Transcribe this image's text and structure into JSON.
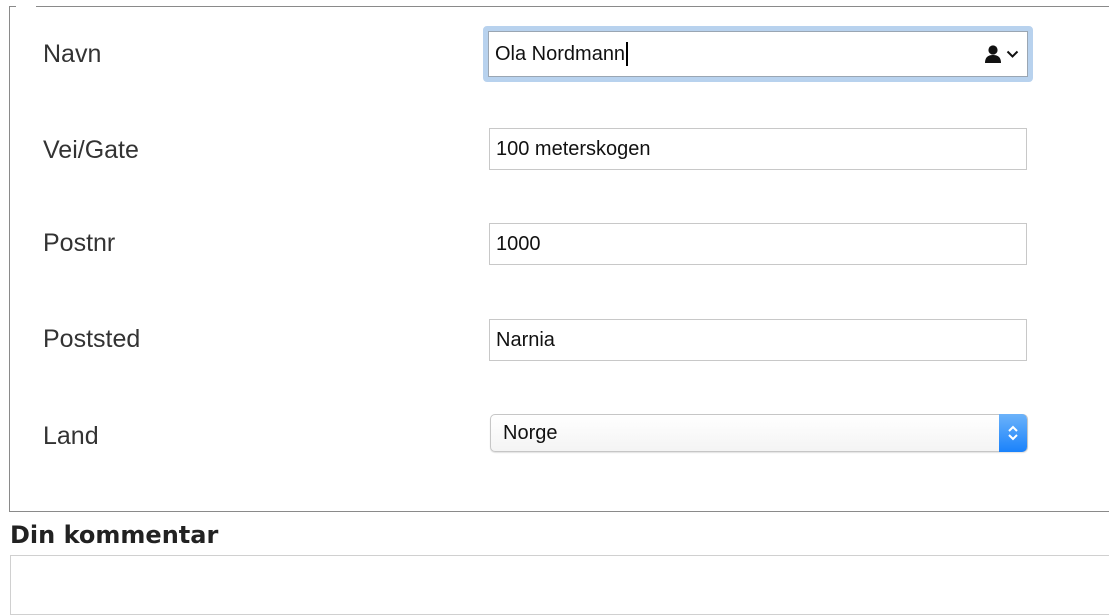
{
  "form": {
    "fields": [
      {
        "key": "navn",
        "label": "Navn",
        "value": "Ola Nordmann"
      },
      {
        "key": "vei",
        "label": "Vei/Gate",
        "value": "100 meterskogen"
      },
      {
        "key": "postnr",
        "label": "Postnr",
        "value": "1000"
      },
      {
        "key": "poststed",
        "label": "Poststed",
        "value": "Narnia"
      },
      {
        "key": "land",
        "label": "Land",
        "value": "Norge"
      }
    ],
    "autofill_icon": "contact-autofill-icon",
    "select_arrows_icon": "select-updown-arrows-icon",
    "focus_color": "#b8d2ee",
    "select_accent": "#1a82fb"
  },
  "comment": {
    "title": "Din kommentar",
    "value": ""
  }
}
